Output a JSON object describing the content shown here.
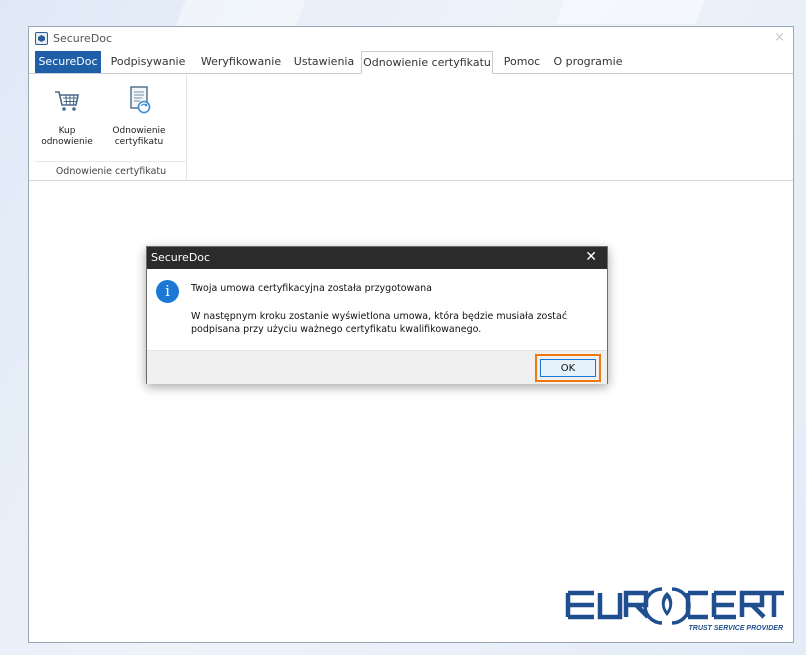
{
  "window": {
    "title": "SecureDoc",
    "close_glyph": "×"
  },
  "tabs": [
    {
      "label": "SecureDoc"
    },
    {
      "label": "Podpisywanie"
    },
    {
      "label": "Weryfikowanie"
    },
    {
      "label": "Ustawienia"
    },
    {
      "label": "Odnowienie certyfikatu"
    },
    {
      "label": "Pomoc"
    },
    {
      "label": "O programie"
    }
  ],
  "active_tab": "Odnowienie certyfikatu",
  "ribbon": {
    "buy_button": {
      "label": "Kup\nodnowienie",
      "icon": "cart-icon"
    },
    "renew_button": {
      "label": "Odnowienie\ncertyfikatu",
      "icon": "certificate-renew-icon"
    },
    "group_label": "Odnowienie certyfikatu"
  },
  "dialog": {
    "title": "SecureDoc",
    "close_glyph": "✕",
    "icon": "info-icon",
    "icon_glyph": "i",
    "main_message": "Twoja umowa certyfikacyjna została przygotowana",
    "detail_message": "W następnym kroku zostanie wyświetlona umowa, która będzie musiała zostać podpisana przy użyciu ważnego certyfikatu kwalifikowanego.",
    "ok_label": "OK"
  },
  "logo": {
    "text": "EUROCERT",
    "tagline": "TRUST SERVICE PROVIDER"
  },
  "colors": {
    "file_tab": "#1f5fa8",
    "highlight": "#ef7a12",
    "info": "#1c78d4",
    "logo": "#1f4f8f"
  }
}
